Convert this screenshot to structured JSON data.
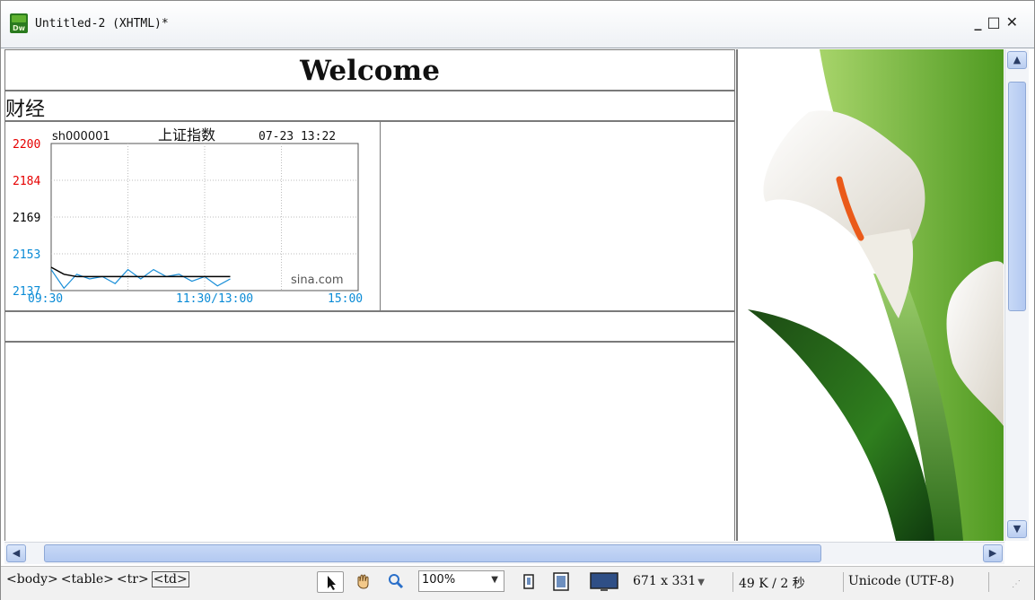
{
  "window": {
    "title": "Untitled-2 (XHTML)*",
    "app_icon_label": "Dw",
    "minimize_label": "_",
    "maximize_label": "□",
    "close_label": "✕"
  },
  "page": {
    "heading": "Welcome",
    "section_label": "财经"
  },
  "stock_chart": {
    "symbol": "sh000001",
    "name": "上证指数",
    "datetime": "07-23 13:22",
    "watermark": "sina.com",
    "y_ticks": [
      "2200",
      "2184",
      "2169",
      "2153",
      "2137"
    ],
    "x_ticks": [
      "09:30",
      "11:30/13:00",
      "15:00"
    ],
    "colors": {
      "up": "#e60000",
      "neutral": "#000000",
      "down": "#0a8bd6",
      "price_line": "#1a8fd8",
      "avg_line": "#000000"
    }
  },
  "chart_data": {
    "type": "line",
    "title": "上证指数",
    "xlabel": "",
    "ylabel": "",
    "ylim": [
      2137,
      2200
    ],
    "x": [
      "09:30",
      "09:40",
      "09:50",
      "10:00",
      "10:10",
      "10:20",
      "10:30",
      "10:40",
      "10:50",
      "11:00",
      "11:10",
      "11:20",
      "11:30/13:00",
      "13:10",
      "13:20"
    ],
    "series": [
      {
        "name": "",
        "values": [
          2146,
          2138,
          2144,
          2142,
          2143,
          2140,
          2146,
          2142,
          2146,
          2143,
          2144,
          2141,
          2143,
          2139,
          2142
        ]
      },
      {
        "name": "",
        "values": [
          2147,
          2144,
          2143,
          2143,
          2143,
          2143,
          2143,
          2143,
          2143,
          2143,
          2143,
          2143,
          2143,
          2143,
          2143
        ]
      }
    ]
  },
  "status_bar": {
    "tag_body": "<body>",
    "tag_table": "<table>",
    "tag_tr": "<tr>",
    "tag_td": "<td>",
    "zoom": "100%",
    "window_size": "671 x 331",
    "download_info": "49 K / 2 秒",
    "encoding": "Unicode (UTF-8)"
  }
}
